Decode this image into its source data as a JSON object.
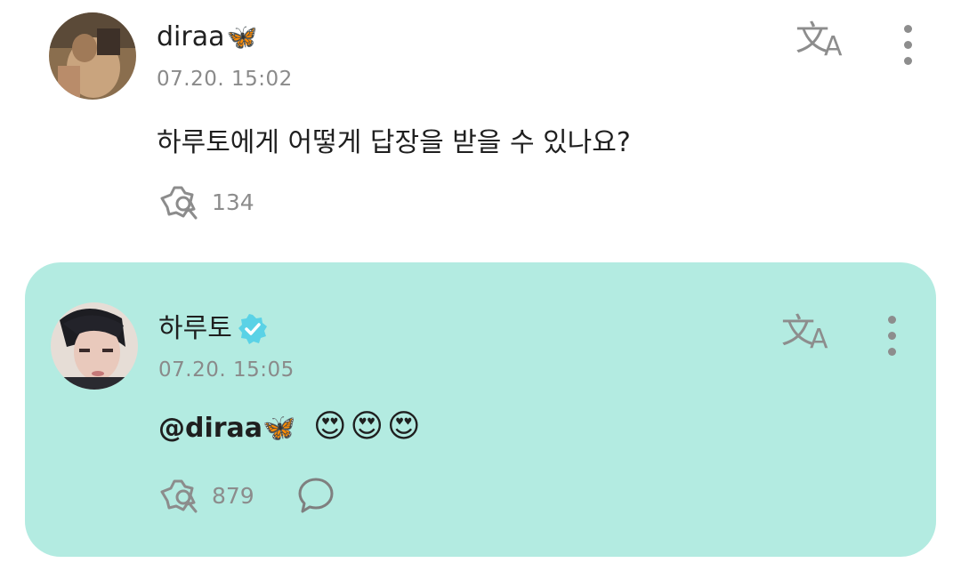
{
  "post": {
    "author": "diraa",
    "author_emoji": "🦋",
    "timestamp": "07.20. 15:02",
    "text": "하루토에게 어떻게 답장을 받을 수 있나요?",
    "like_count": "134",
    "translate_icon": "文A"
  },
  "reply": {
    "author": "하루토",
    "verified": true,
    "timestamp": "07.20. 15:05",
    "mention": "@diraa🦋",
    "emojis": "😍😍😍",
    "like_count": "879",
    "translate_icon": "文A",
    "background_color": "#b3ebe1",
    "verified_color": "#5ad2e6"
  }
}
